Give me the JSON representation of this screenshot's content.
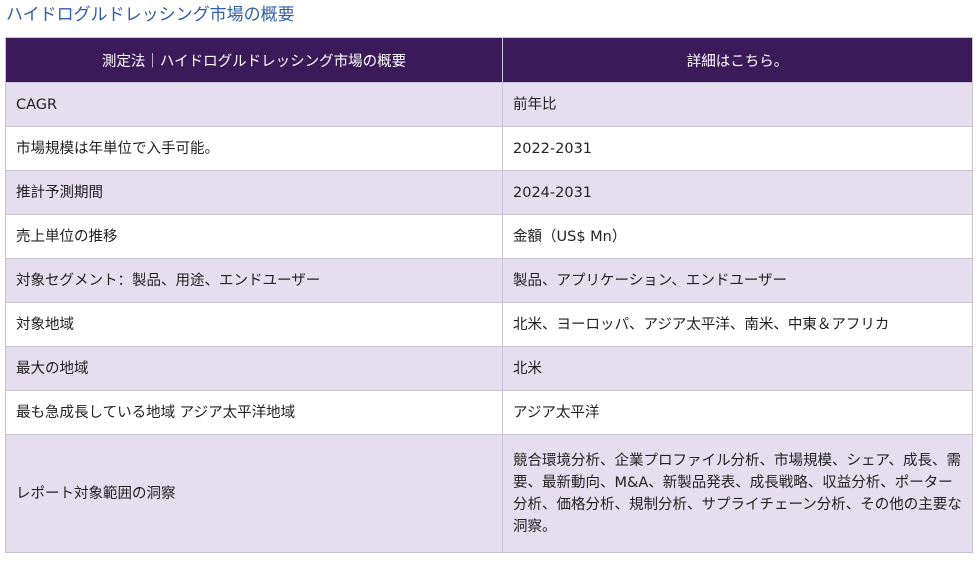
{
  "page_title": "ハイドログルドレッシング市場の概要",
  "table": {
    "headers": [
      "測定法｜ハイドログルドレッシング市場の概要",
      "詳細はこちら。"
    ],
    "rows": [
      [
        "CAGR",
        "前年比"
      ],
      [
        "市場規模は年単位で入手可能。",
        "2022-2031"
      ],
      [
        "推計予測期間",
        "2024-2031"
      ],
      [
        "売上単位の推移",
        "金額（US$ Mn）"
      ],
      [
        "対象セグメント：製品、用途、エンドユーザー",
        "製品、アプリケーション、エンドユーザー"
      ],
      [
        "対象地域",
        "北米、ヨーロッパ、アジア太平洋、南米、中東＆アフリカ"
      ],
      [
        "最大の地域",
        "北米"
      ],
      [
        "最も急成長している地域 アジア太平洋地域",
        "アジア太平洋"
      ],
      [
        "レポート対象範囲の洞察",
        "競合環境分析、企業プロファイル分析、市場規模、シェア、成長、需要、最新動向、M&A、新製品発表、成長戦略、収益分析、ポーター分析、価格分析、規制分析、サプライチェーン分析、その他の主要な洞察。"
      ]
    ]
  },
  "colors": {
    "header_bg": "#3b1a59",
    "row_alt_bg": "#e4deef",
    "title": "#2f5fa8"
  }
}
